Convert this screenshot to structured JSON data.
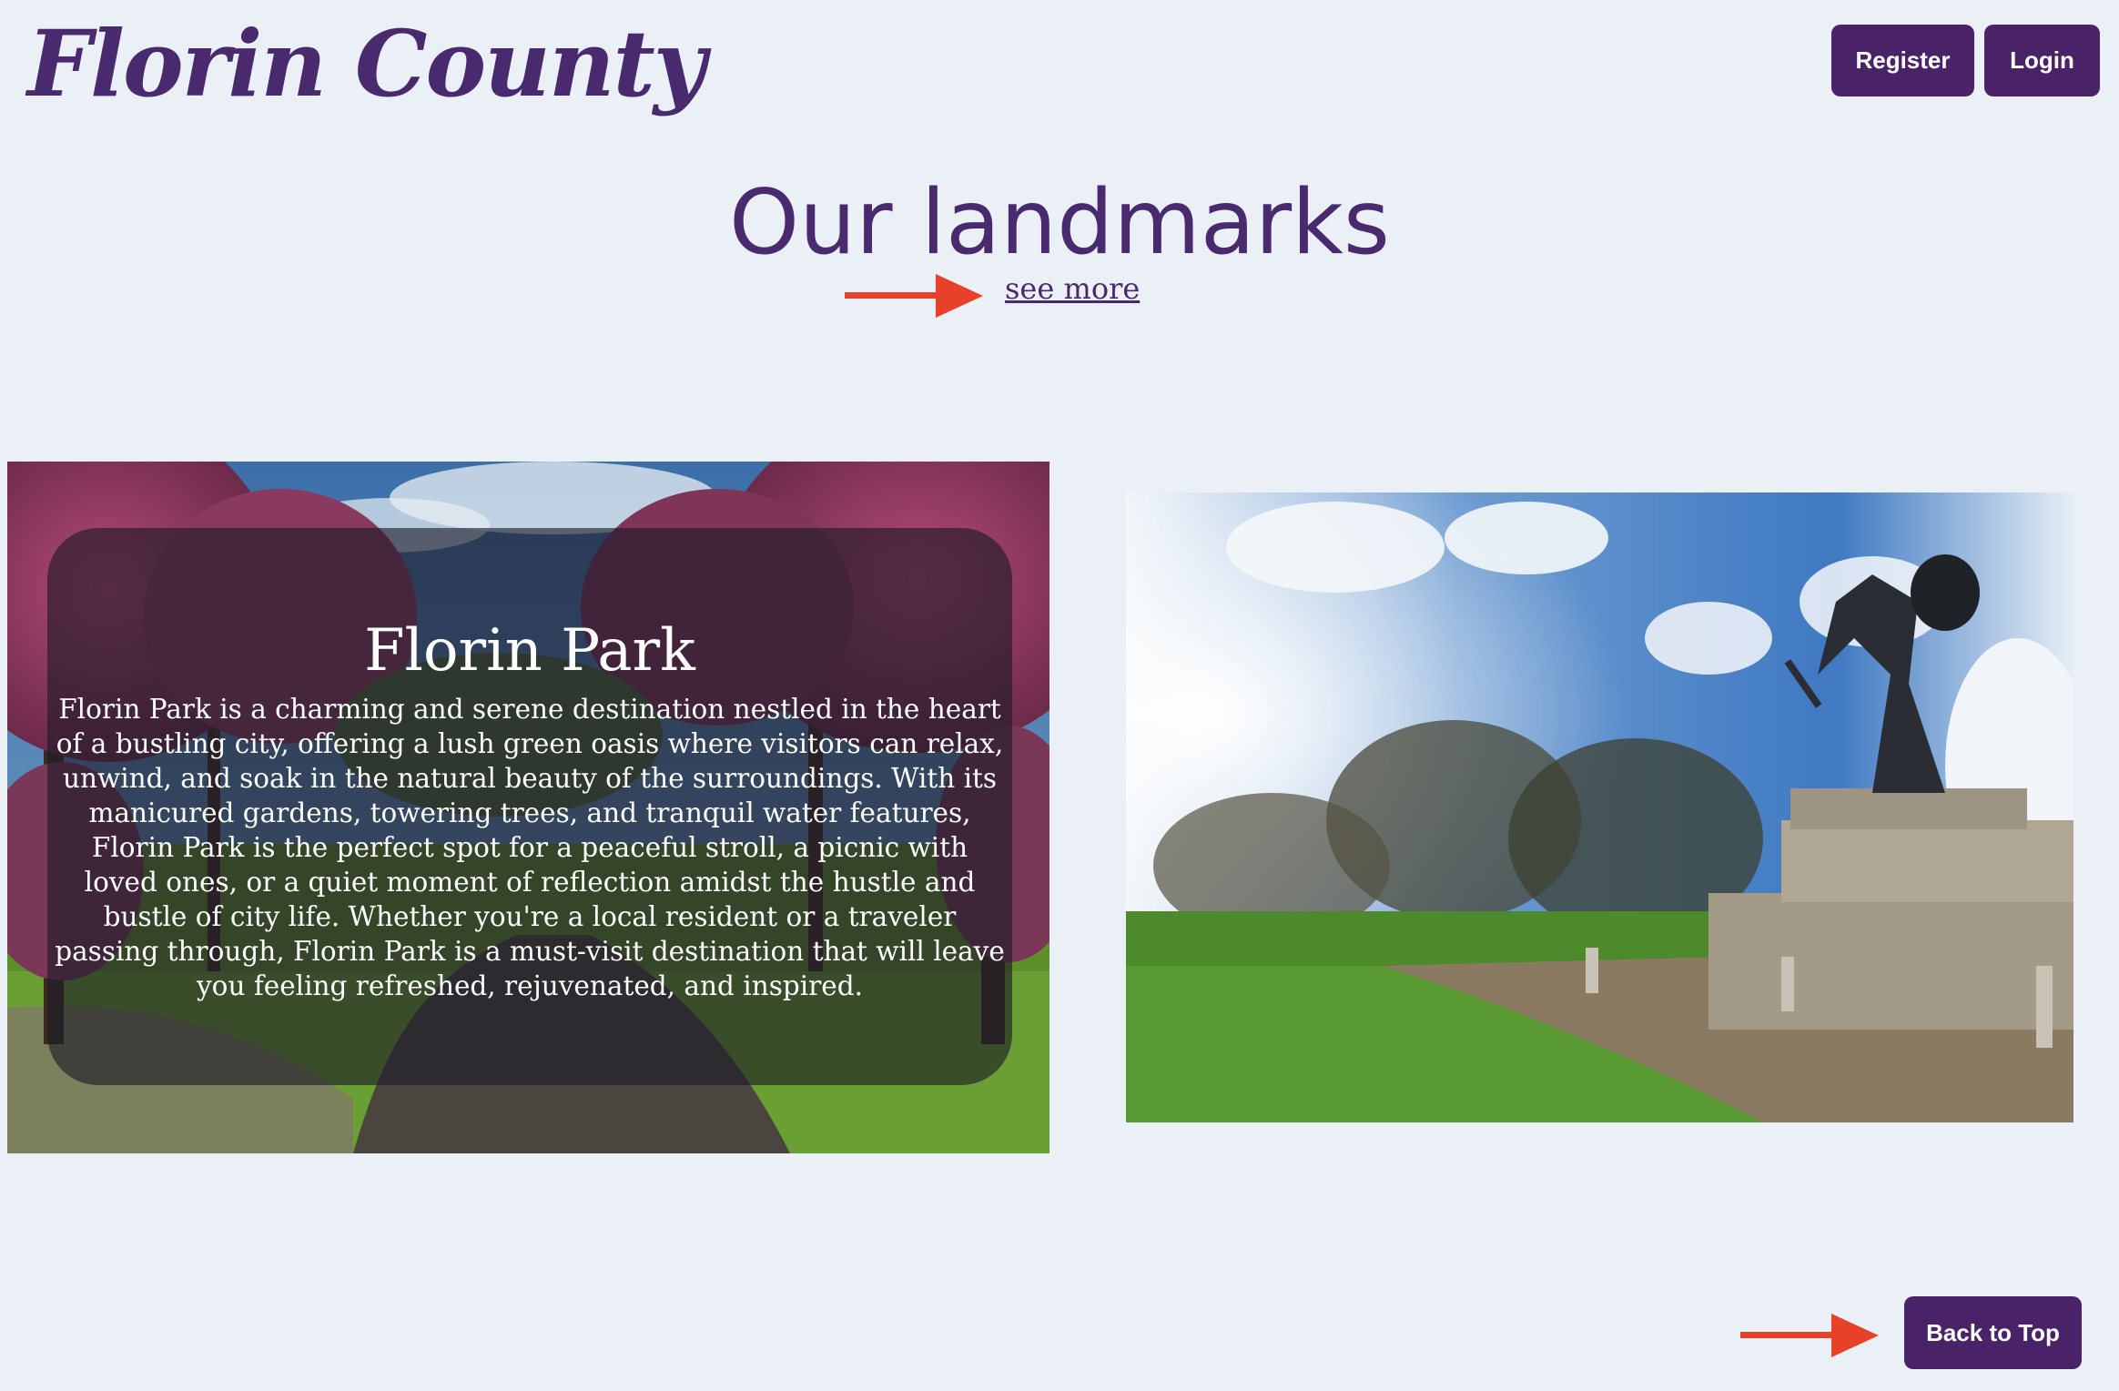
{
  "header": {
    "logo_text": "Florin County",
    "register_label": "Register",
    "login_label": "Login"
  },
  "landmarks": {
    "heading": "Our landmarks",
    "see_more_label": "see more",
    "park": {
      "title": "Florin Park",
      "description": "Florin Park is a charming and serene destination nestled in the heart of a bustling city, offering a lush green oasis where visitors can relax, unwind, and soak in the natural beauty of the surroundings. With its manicured gardens, towering trees, and tranquil water features, Florin Park is the perfect spot for a peaceful stroll, a picnic with loved ones, or a quiet moment of reflection amidst the hustle and bustle of city life. Whether you're a local resident or a traveler passing through, Florin Park is a must-visit destination that will leave you feeling refreshed, rejuvenated, and inspired."
    }
  },
  "footer": {
    "back_to_top_label": "Back to Top"
  },
  "colors": {
    "brand_purple": "#4a2268",
    "background": "#ebf0f7",
    "annotation_arrow": "#e8412a"
  }
}
